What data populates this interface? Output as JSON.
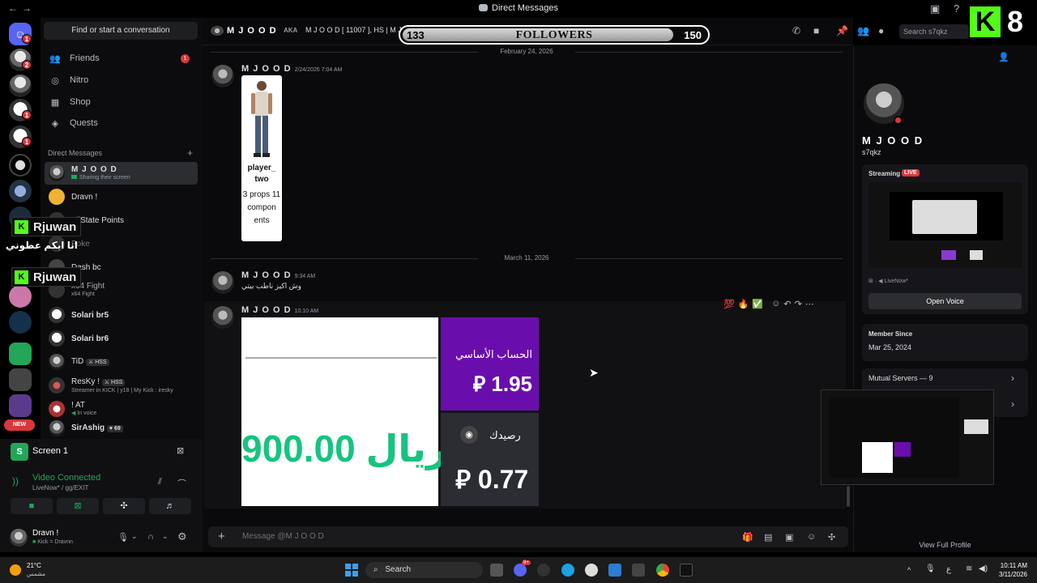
{
  "window": {
    "title": "Direct Messages",
    "back": "←",
    "forward": "→"
  },
  "sidebar": {
    "find_conversation": "Find or start a conversation",
    "nav": [
      {
        "label": "Friends",
        "icon": "friends-icon",
        "badge": "1"
      },
      {
        "label": "Nitro",
        "icon": "nitro-icon"
      },
      {
        "label": "Shop",
        "icon": "shop-icon"
      },
      {
        "label": "Quests",
        "icon": "quests-icon"
      }
    ],
    "dm_header": "Direct Messages",
    "dms": [
      {
        "name": "M J O O D",
        "sub": "Sharing their screen"
      },
      {
        "name": "Dravn !",
        "sub": ""
      },
      {
        "name": "AllState Points",
        "sub": ""
      },
      {
        "name": "Poke",
        "sub": ""
      },
      {
        "name": "Dash bc",
        "sub": ""
      },
      {
        "name": "x64 Fight",
        "sub": "x64 Fight"
      },
      {
        "name": "Solari br5",
        "sub": ""
      },
      {
        "name": "Solari br6",
        "sub": ""
      },
      {
        "name": "TiD",
        "tag": "HSS",
        "sub": ""
      },
      {
        "name": "ResKy !",
        "tag": "HSS",
        "sub": "Streamer in KICK | y18 | My Kick : iresky"
      },
      {
        "name": "! AT",
        "sub": "In voice"
      },
      {
        "name": "SirAshig",
        "tag": "69",
        "sub": ""
      }
    ],
    "server_badges": [
      "1",
      "2",
      "1",
      "1",
      "1"
    ],
    "new_badge": "NEW"
  },
  "overlay": {
    "kick_name_1": "Rjuwan",
    "kick_name_2": "Rjuwan",
    "arabic_caption": "انا ابكم عطوني",
    "followers_current": "133",
    "followers_label": "FOLLOWERS",
    "followers_goal": "150",
    "followers_fraction": 0.887,
    "corner_number": "8"
  },
  "screen_panel": {
    "title": "Screen 1",
    "status": "Video Connected",
    "substatus": "LiveNow* / gg/EXIT"
  },
  "user": {
    "name": "Dravn !",
    "sub": "Kick = Dravnn"
  },
  "chat_header": {
    "name": "M J O O D",
    "aka_label": "AKA",
    "aka": "M J O O D [ 11007 ], HS | M J",
    "search_placeholder": "Search s7qkz"
  },
  "messages": {
    "date1": "February 24, 2026",
    "m1_author": "M J O O D",
    "m1_time": "2/24/2026 7:04 AM",
    "card_name": "player_ two",
    "card_stats": "3 props 11 compon ents",
    "date2": "March 11, 2026",
    "m2_author": "M J O O D",
    "m2_time": "9:34 AM",
    "m2_text": "وش اكيز ناطب بيتي",
    "m3_author": "M J O O D",
    "m3_time": "10:10 AM",
    "reactions": [
      "💯",
      "🔥",
      "✅"
    ],
    "bank_amount": "ريال 900.00",
    "basic_account_label": "الحساب الأساسي",
    "basic_account_value": "1.95",
    "balance_label": "رصيدك",
    "balance_value": "0.77",
    "currency_symbol": "⃁"
  },
  "composer": {
    "placeholder": "Message @M J O O D"
  },
  "profile": {
    "display_name": "M J O O D",
    "username": "s7qkz",
    "streaming_label": "Streaming",
    "live_badge": "LIVE",
    "activity": "LiveNow*",
    "open_voice": "Open Voice",
    "member_since_label": "Member Since",
    "member_since": "Mar 25, 2024",
    "mutual_servers": "Mutual Servers — 9",
    "view_full": "View Full Profile"
  },
  "taskbar": {
    "weather_temp": "21°C",
    "weather_desc": "مشمس",
    "search": "Search",
    "time": "10:11 AM",
    "date": "3/11/2026",
    "lang": "ع",
    "discord_badge": "9+"
  },
  "colors": {
    "accent": "#5865f2",
    "danger": "#da373c",
    "kick": "#53fc18",
    "bank_purple": "#6a0dad",
    "bank_green": "#16c47f"
  }
}
